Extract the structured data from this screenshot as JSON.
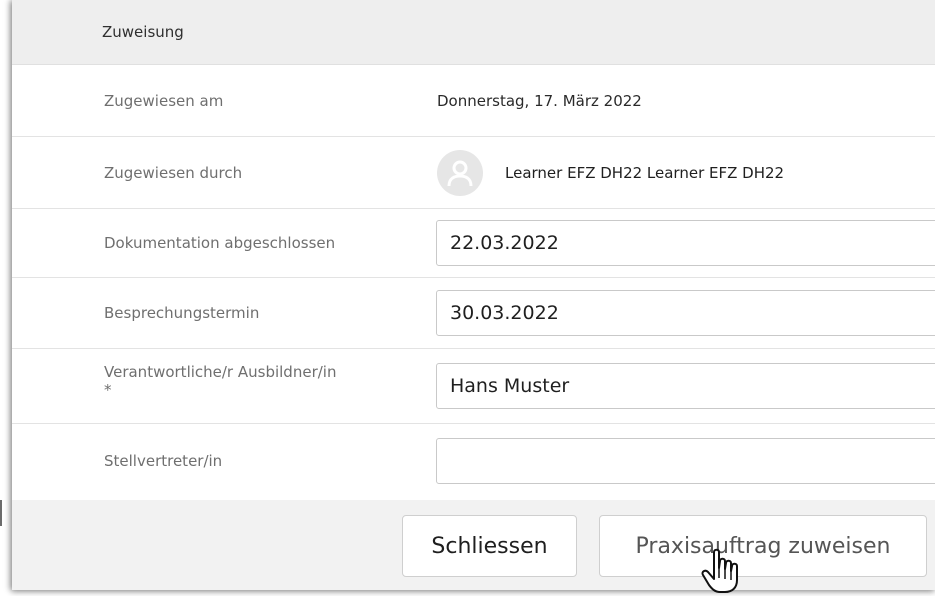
{
  "section": {
    "title": "Zuweisung"
  },
  "rows": {
    "assigned_on": {
      "label": "Zugewiesen am",
      "value": "Donnerstag, 17. März 2022"
    },
    "assigned_by": {
      "label": "Zugewiesen durch",
      "value": "Learner EFZ DH22 Learner EFZ DH22"
    },
    "documentation_completed": {
      "label": "Dokumentation abgeschlossen",
      "value": "22.03.2022"
    },
    "meeting_date": {
      "label": "Besprechungstermin",
      "value": "30.03.2022"
    },
    "responsible_trainer": {
      "label": "Verantwortliche/r Ausbildner/in",
      "required_marker": "*",
      "value": "Hans Muster"
    },
    "deputy": {
      "label": "Stellvertreter/in",
      "value": ""
    }
  },
  "buttons": {
    "close": "Schliessen",
    "assign": "Praxisauftrag zuweisen"
  },
  "icons": {
    "avatar": "user-avatar-icon",
    "cursor": "hand-pointer-cursor-icon"
  },
  "colors": {
    "header_bg": "#eeeeee",
    "footer_bg": "#f2f2f2",
    "label_text": "#6f6f6f",
    "border": "#c9c9c9"
  }
}
